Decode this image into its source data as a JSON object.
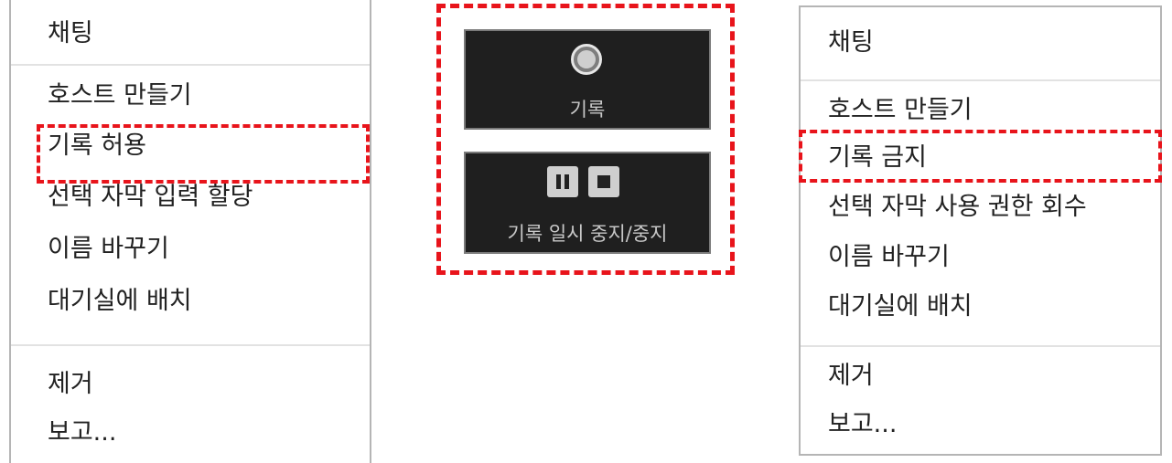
{
  "left_menu": {
    "items": [
      "채팅",
      "호스트 만들기",
      "기록 허용",
      "선택 자막 입력 할당",
      "이름 바꾸기",
      "대기실에 배치",
      "제거",
      "보고..."
    ]
  },
  "center_panel": {
    "record_button": {
      "label": "기록",
      "icon": "record-circle-icon"
    },
    "pause_stop_button": {
      "label": "기록 일시 중지/중지",
      "icons": [
        "pause-icon",
        "stop-icon"
      ]
    }
  },
  "right_menu": {
    "items": [
      "채팅",
      "호스트 만들기",
      "기록 금지",
      "선택 자막 사용 권한 회수",
      "이름 바꾸기",
      "대기실에 배치",
      "제거",
      "보고..."
    ]
  },
  "colors": {
    "highlight": "#e8141b",
    "button_bg": "#1f1f1f",
    "menu_border": "#b5b5b5",
    "divider": "#e2e2e2"
  }
}
